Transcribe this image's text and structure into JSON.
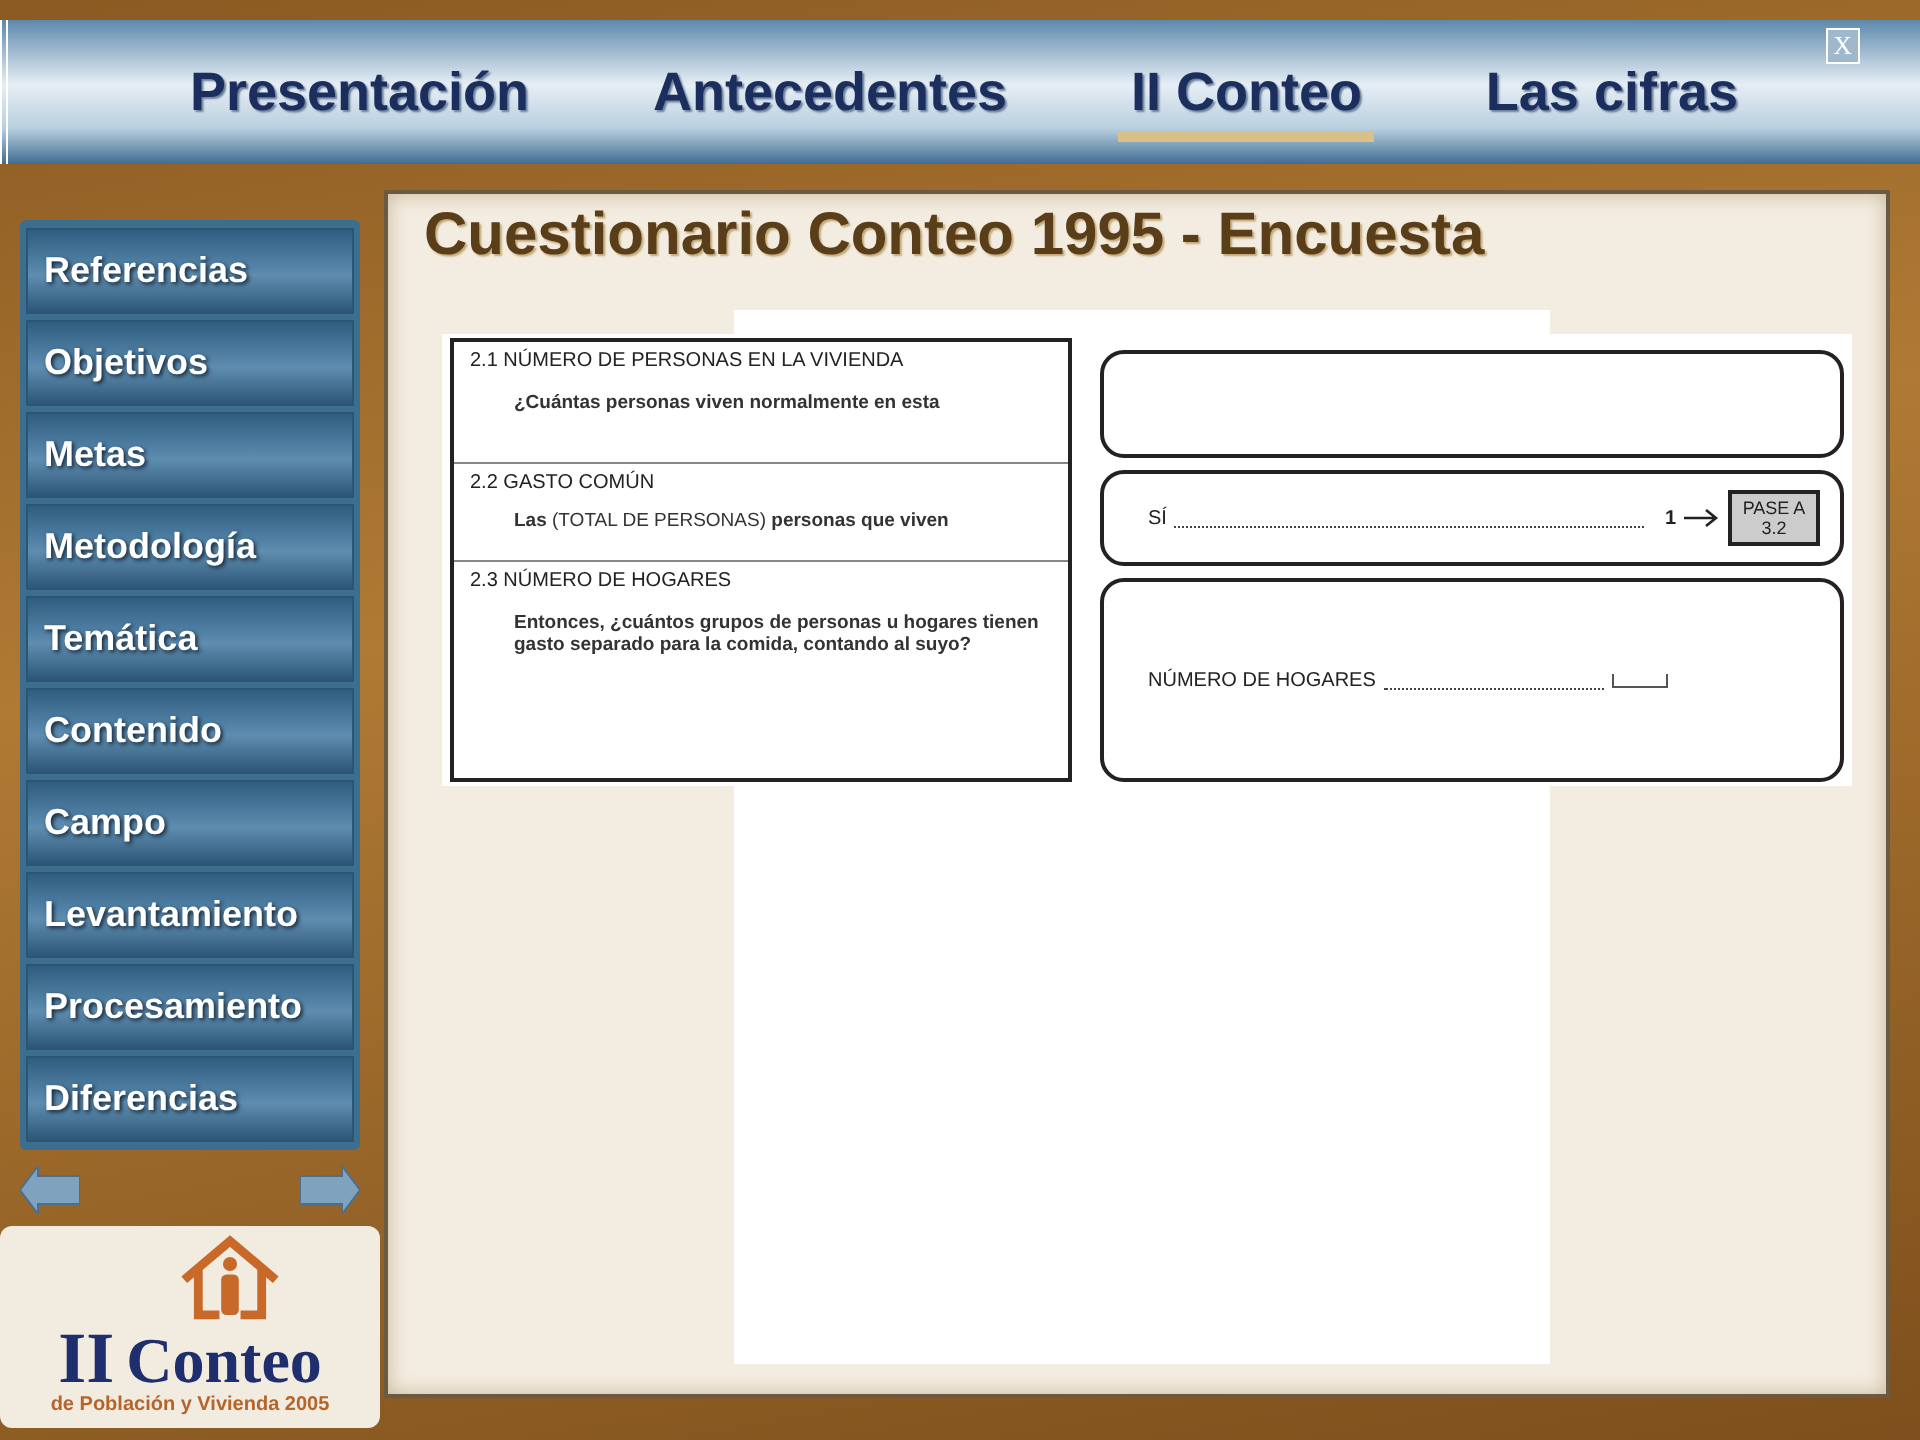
{
  "nav": {
    "tabs": [
      {
        "label": "Presentación",
        "selected": false
      },
      {
        "label": "Antecedentes",
        "selected": false
      },
      {
        "label": "II Conteo",
        "selected": true
      },
      {
        "label": "Las cifras",
        "selected": false
      }
    ],
    "close": "X"
  },
  "sidebar": {
    "items": [
      "Referencias",
      "Objetivos",
      "Metas",
      "Metodología",
      "Temática",
      "Contenido",
      "Campo",
      "Levantamiento",
      "Procesamiento",
      "Diferencias"
    ]
  },
  "logo": {
    "title_a": "II",
    "title_b": "Conteo",
    "subtitle": "de Población y Vivienda 2005"
  },
  "title": "Cuestionario Conteo 1995 - Encuesta",
  "questionnaire": {
    "questions": [
      {
        "heading": "2.1  NÚMERO  DE  PERSONAS  EN  LA  VIVIENDA",
        "text": "¿Cuántas personas viven normalmente en esta"
      },
      {
        "heading": "2.2  GASTO  COMÚN",
        "text": "**Las** (TOTAL DE PERSONAS) **personas que viven**"
      },
      {
        "heading": "2.3  NÚMERO  DE  HOGARES",
        "text": "Entonces, ¿cuántos grupos de personas u hogares tienen gasto separado para la comida, contando al suyo?"
      }
    ],
    "answers": [
      {
        "kind": "blank"
      },
      {
        "kind": "option",
        "label": "SÍ",
        "code": "1",
        "skip": "PASE A 3.2"
      },
      {
        "kind": "count",
        "label": "NÚMERO  DE  HOGARES"
      }
    ]
  }
}
